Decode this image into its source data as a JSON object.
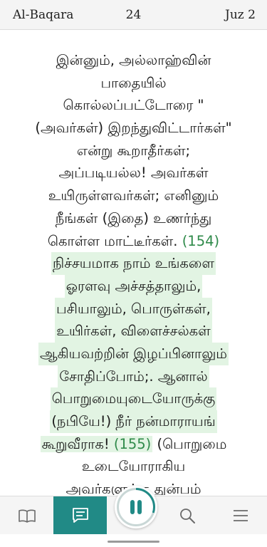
{
  "header": {
    "surah_name": "Al-Baqara",
    "page_number": "24",
    "juz_label": "Juz 2"
  },
  "reader": {
    "lines": [
      {
        "text": "இன்னும், அல்லாஹ்வின்",
        "highlighted": false
      },
      {
        "text": "பாதையில்",
        "highlighted": false
      },
      {
        "text": "கொல்லப்பட்டோரை \"",
        "highlighted": false
      },
      {
        "text": "(அவர்கள்) இறந்துவிட்டார்கள்\"",
        "highlighted": false
      },
      {
        "text": "என்று கூறாதீர்கள்;",
        "highlighted": false
      },
      {
        "text": "அப்படியல்ல! அவர்கள்",
        "highlighted": false
      },
      {
        "text": "உயிருள்ளவர்கள்; எனினும்",
        "highlighted": false
      },
      {
        "text": "நீங்கள் (இதை) உணர்ந்து",
        "highlighted": false
      },
      {
        "text": "கொள்ள மாட்டீர்கள்.",
        "verse": "(154)",
        "highlighted": false
      },
      {
        "text": "நிச்சயமாக நாம் உங்களை",
        "highlighted": true
      },
      {
        "text": "ஓரளவு அச்சத்தாலும்,",
        "highlighted": true
      },
      {
        "text": "பசியாலும், பொருள்கள்,",
        "highlighted": true
      },
      {
        "text": "உயிர்கள், விளைச்சல்கள்",
        "highlighted": true
      },
      {
        "text": "ஆகியவற்றின் இழப்பினாலும்",
        "highlighted": true
      },
      {
        "text": "சோதிப்போம்;. ஆனால்",
        "highlighted": true
      },
      {
        "text": "பொறுமையுடையோருக்கு",
        "highlighted": true
      },
      {
        "text": "(நபியே!) நீர் நன்மாராயங்",
        "highlighted": true
      },
      {
        "text": "கூறுவீராக!",
        "verse": "(155)",
        "after": "(பொறுமை",
        "highlighted": true,
        "partial": true
      },
      {
        "text": "உடையோராகிய",
        "highlighted": false
      },
      {
        "text": "அவர்களுக்கு துன்பம்",
        "highlighted": false
      }
    ],
    "highlight_color": "#e2f4e3",
    "verse_number_color": "#2f8a4a"
  },
  "bottom_nav": {
    "items": [
      {
        "name": "quran-book",
        "icon": "book-icon",
        "active": false
      },
      {
        "name": "translation",
        "icon": "translation-icon",
        "active": true
      },
      {
        "name": "play-pause",
        "icon": "pause-icon",
        "active": false
      },
      {
        "name": "search",
        "icon": "search-icon",
        "active": false
      },
      {
        "name": "menu",
        "icon": "menu-icon",
        "active": false
      }
    ],
    "accent_color": "#218a86",
    "audio_progress": 0.3
  }
}
